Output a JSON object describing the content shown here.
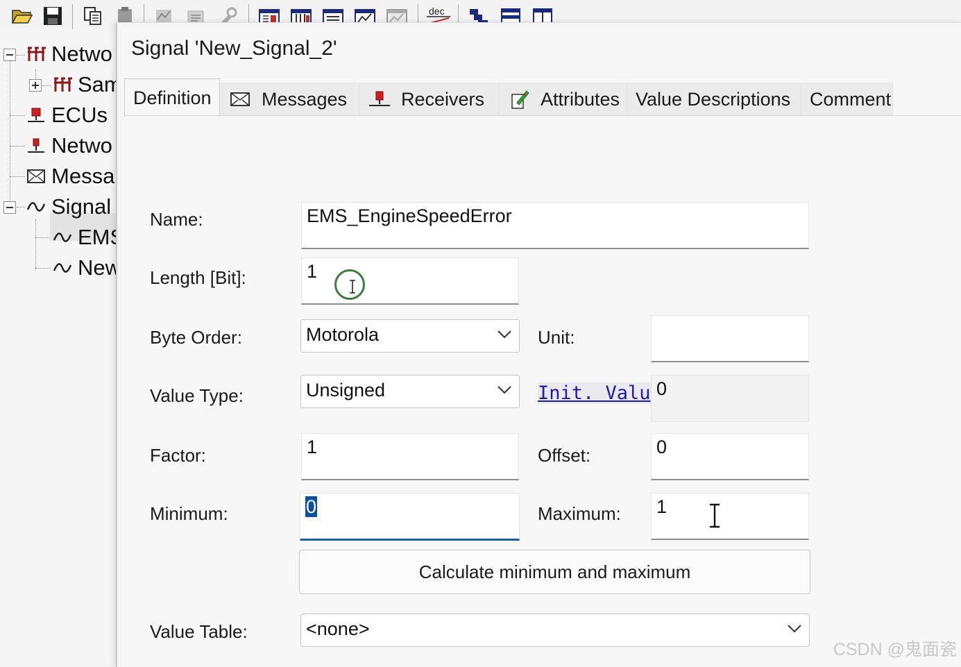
{
  "toolbar": {
    "buttons": [
      "open-folder-icon",
      "save-icon",
      "copy-icon",
      "paste-icon",
      "signal-tool-icon",
      "list-icon",
      "wrench-icon",
      "view1-icon",
      "view2-icon",
      "view3-icon",
      "view4-icon",
      "view5-icon",
      "dec-icon",
      "network-icon",
      "bus-icon",
      "split-view-icon"
    ],
    "dec_label": "dec"
  },
  "tree": {
    "items": [
      {
        "label": "Netwo",
        "icon": "network-icon",
        "expander": "minus"
      },
      {
        "label": "Sam",
        "icon": "network-icon",
        "expander": "plus"
      },
      {
        "label": "ECUs",
        "icon": "ecu-icon"
      },
      {
        "label": "Netwo",
        "icon": "node-icon"
      },
      {
        "label": "Messa",
        "icon": "message-icon"
      },
      {
        "label": "Signal",
        "icon": "signal-icon",
        "expander": "minus"
      },
      {
        "label": "EMS",
        "icon": "signal-icon"
      },
      {
        "label": "New",
        "icon": "signal-icon"
      }
    ]
  },
  "dialog": {
    "title": "Signal 'New_Signal_2'",
    "tabs": [
      {
        "label": "Definition",
        "icon": ""
      },
      {
        "label": "Messages",
        "icon": "envelope-icon"
      },
      {
        "label": "Receivers",
        "icon": "ecu-icon"
      },
      {
        "label": "Attributes",
        "icon": "edit-attributes-icon"
      },
      {
        "label": "Value Descriptions",
        "icon": ""
      },
      {
        "label": "Comment",
        "icon": ""
      }
    ],
    "form": {
      "name_label": "Name:",
      "name_value": "EMS_EngineSpeedError",
      "length_label": "Length [Bit]:",
      "length_value": "1",
      "byte_order_label": "Byte Order:",
      "byte_order_value": "Motorola",
      "unit_label": "Unit:",
      "unit_value": "",
      "value_type_label": "Value Type:",
      "value_type_value": "Unsigned",
      "init_value_link": "Init. Valu",
      "init_value_value": "0",
      "factor_label": "Factor:",
      "factor_value": "1",
      "offset_label": "Offset:",
      "offset_value": "0",
      "minimum_label": "Minimum:",
      "minimum_value": "0",
      "maximum_label": "Maximum:",
      "maximum_value": "1",
      "calc_button": "Calculate minimum and maximum",
      "value_table_label": "Value Table:",
      "value_table_value": "<none>"
    }
  },
  "watermark": "CSDN @鬼面瓷",
  "colors": {
    "focus_underline": "#1c5fa8",
    "selection": "#0b4ea2",
    "link": "#1d1da6"
  }
}
